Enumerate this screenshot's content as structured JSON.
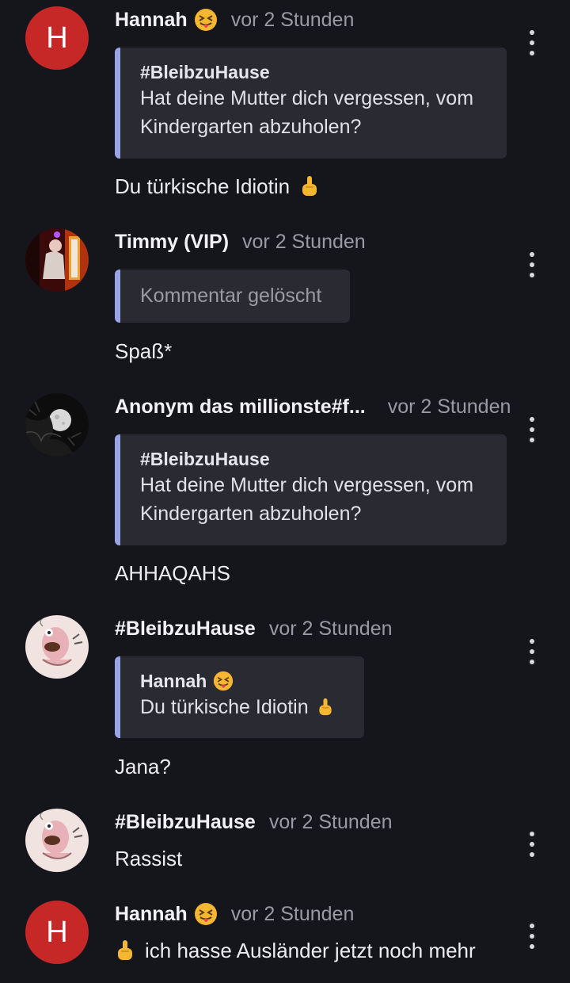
{
  "comments": [
    {
      "author": "Hannah",
      "avatar_letter": "H",
      "time": "vor 2 Stunden",
      "quote": {
        "author": "#BleibzuHause",
        "line1": "Hat deine Mutter dich vergessen, vom",
        "line2": "Kindergarten abzuholen?"
      },
      "text": "Du türkische Idiotin"
    },
    {
      "author": "Timmy (VIP)",
      "time": "vor 2 Stunden",
      "quote": {
        "deleted": "Kommentar gelöscht"
      },
      "text": "Spaß*"
    },
    {
      "author": "Anonym das millionste#f...",
      "time": "vor 2 Stunden",
      "quote": {
        "author": "#BleibzuHause",
        "line1": "Hat deine Mutter dich vergessen, vom",
        "line2": "Kindergarten abzuholen?"
      },
      "text": "AHHAQAHS"
    },
    {
      "author": "#BleibzuHause",
      "time": "vor 2 Stunden",
      "quote": {
        "author": "Hannah",
        "line1": "Du türkische Idiotin"
      },
      "text": "Jana?"
    },
    {
      "author": "#BleibzuHause",
      "time": "vor 2 Stunden",
      "text": "Rassist"
    },
    {
      "author": "Hannah",
      "avatar_letter": "H",
      "time": "vor 2 Stunden",
      "text": "ich hasse Ausländer jetzt noch mehr"
    }
  ],
  "icons": {
    "menu": "more-vert-icon",
    "author_emoji": "tongue-out-face-emoji",
    "gesture_emoji": "middle-finger-emoji"
  },
  "colors": {
    "background": "#15151c",
    "quote_background": "#2a2a33",
    "quote_accent": "#9aa3e8",
    "avatar_red": "#c62828",
    "timestamp": "#9a9aa4"
  }
}
